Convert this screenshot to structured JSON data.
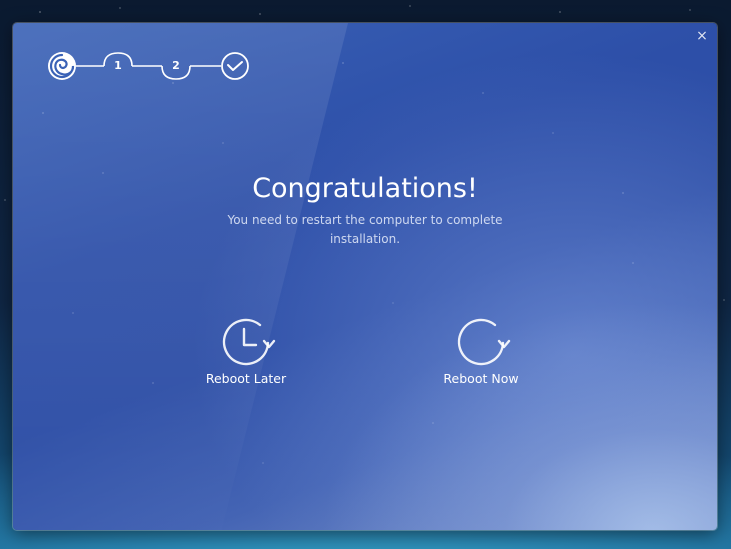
{
  "window": {
    "close_icon": "close-icon",
    "close_glyph": "×"
  },
  "stepper": {
    "logo_icon": "deepin-logo-icon",
    "steps": [
      {
        "label": "1",
        "state": "done"
      },
      {
        "label": "2",
        "state": "done"
      },
      {
        "label": "",
        "state": "current",
        "icon": "checkmark-icon"
      }
    ]
  },
  "main": {
    "title": "Congratulations!",
    "subtitle_line1": "You need to restart the computer to complete",
    "subtitle_line2": "installation."
  },
  "actions": {
    "reboot_later": {
      "label": "Reboot Later",
      "icon": "clock-arrow-icon"
    },
    "reboot_now": {
      "label": "Reboot Now",
      "icon": "refresh-icon"
    }
  },
  "colors": {
    "accent_text": "#ffffff",
    "window_gradient_start": "#3a62b6",
    "window_gradient_end": "#7f97cc"
  }
}
